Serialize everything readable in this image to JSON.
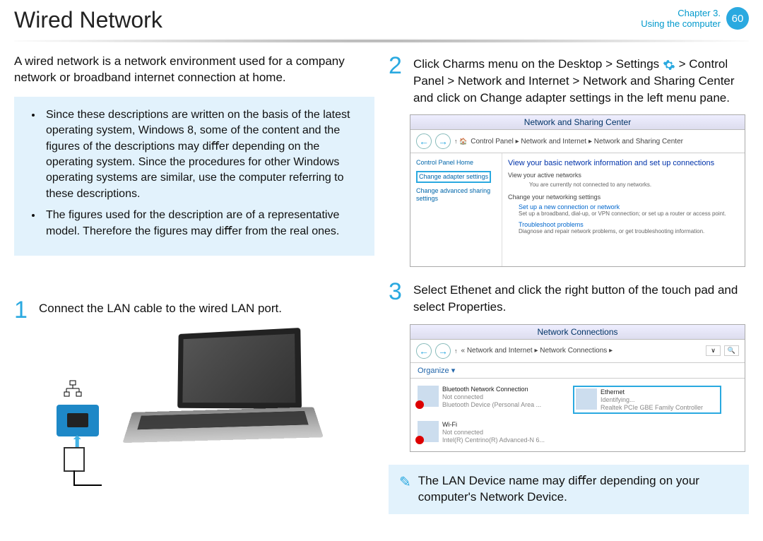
{
  "header": {
    "title": "Wired Network",
    "chapter": "Chapter 3.",
    "section": "Using the computer",
    "page": "60"
  },
  "intro": "A wired network is a network environment used for a company network or broadband internet connection at home.",
  "notes": {
    "n1": "Since these descriptions are written on the basis of the latest operating system, Windows 8, some of the content and the ﬁgures of the descriptions may diﬀer depending on the operating system. Since the procedures for other Windows operating systems are similar, use the computer referring to these descriptions.",
    "n2": "The ﬁgures used for the description are of a representative model. Therefore the ﬁgures may diﬀer from the real ones."
  },
  "steps": {
    "s1_num": "1",
    "s1_text": "Connect the LAN cable to the wired LAN port.",
    "s2_num": "2",
    "s2_text_a": "Click Charms menu on the Desktop > Settings",
    "s2_text_b": " > Control Panel > Network and Internet > Network and Sharing Center and click on Change adapter settings in the left menu pane.",
    "s3_num": "3",
    "s3_text": "Select Ethenet and click the right button of the touch pad and select Properties."
  },
  "sc1": {
    "title": "Network and Sharing Center",
    "crumb": "Control Panel  ▸  Network and Internet  ▸  Network and Sharing Center",
    "left1": "Control Panel Home",
    "left2": "Change adapter settings",
    "left3": "Change advanced sharing settings",
    "r_head": "View your basic network information and set up connections",
    "r_active": "View your active networks",
    "r_noconn": "You are currently not connected to any networks.",
    "r_change": "Change your networking settings",
    "r_link1": "Set up a new connection or network",
    "r_desc1": "Set up a broadband, dial-up, or VPN connection; or set up a router or access point.",
    "r_link2": "Troubleshoot problems",
    "r_desc2": "Diagnose and repair network problems, or get troubleshooting information."
  },
  "sc2": {
    "title": "Network Connections",
    "crumb": "«  Network and Internet  ▸  Network Connections  ▸",
    "organize": "Organize ▾",
    "i1_name": "Bluetooth Network Connection",
    "i1_status": "Not connected",
    "i1_detail": "Bluetooth Device (Personal Area ...",
    "i2_name": "Ethernet",
    "i2_status": "Identifying...",
    "i2_detail": "Realtek PCIe GBE Family Controller",
    "i3_name": "Wi-Fi",
    "i3_status": "Not connected",
    "i3_detail": "Intel(R) Centrino(R) Advanced-N 6..."
  },
  "footnote": "The LAN Device name may diﬀer depending on your computer's Network Device."
}
